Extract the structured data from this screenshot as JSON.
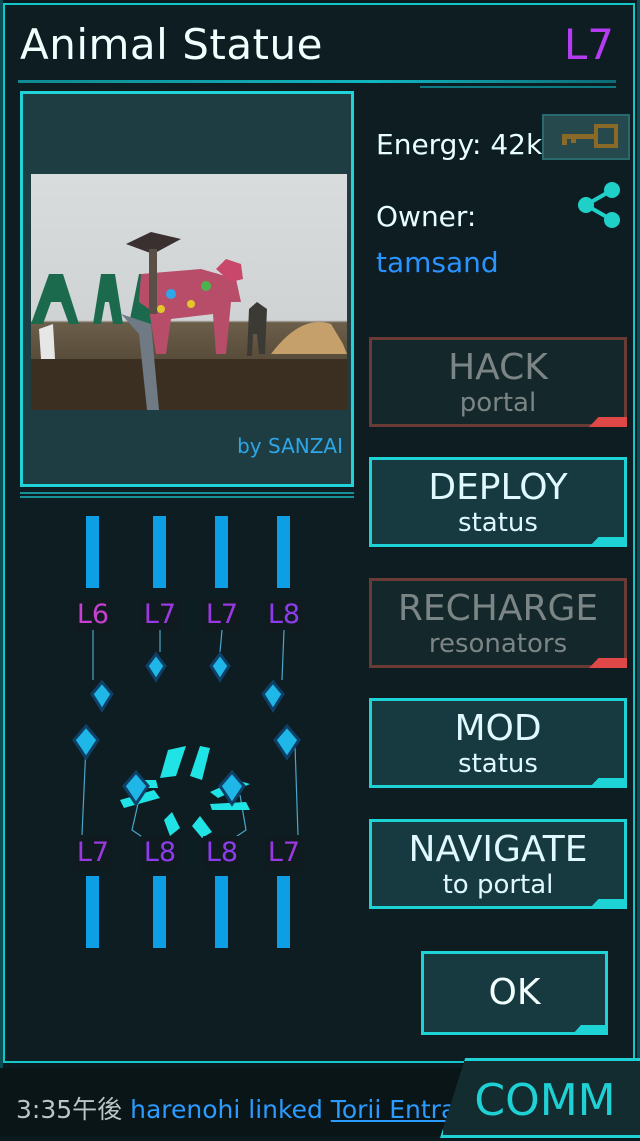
{
  "portal": {
    "title": "Animal Statue",
    "level": "L7",
    "photo_credit": "by SANZAI",
    "energy": "Energy: 42k",
    "owner_label": "Owner:",
    "owner_name": "tamsand"
  },
  "actions": {
    "hack": {
      "line1": "HACK",
      "line2": "portal"
    },
    "deploy": {
      "line1": "DEPLOY",
      "line2": "status"
    },
    "recharge": {
      "line1": "RECHARGE",
      "line2": "resonators"
    },
    "mod": {
      "line1": "MOD",
      "line2": "status"
    },
    "navigate": {
      "line1": "NAVIGATE",
      "line2": "to portal"
    },
    "ok": "OK"
  },
  "resonators": {
    "top": [
      "L6",
      "L7",
      "L7",
      "L8"
    ],
    "bottom": [
      "L7",
      "L8",
      "L8",
      "L7"
    ]
  },
  "comm": {
    "label": "COMM",
    "time": "3:35午後",
    "agent": "harenohi",
    "action": "linked",
    "portal": "Torii Entrance"
  },
  "icons": {
    "key": "key-icon",
    "share": "share-icon"
  },
  "colors": {
    "accent": "#1ed3d6",
    "level": "#b63cf2",
    "owner": "#2b93ff",
    "disabled_corner": "#e04848"
  }
}
